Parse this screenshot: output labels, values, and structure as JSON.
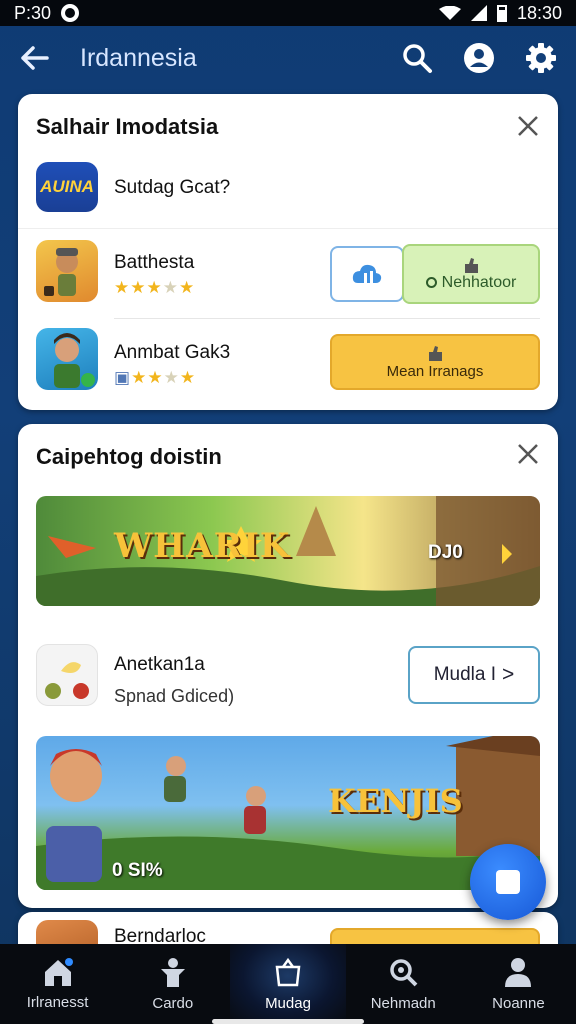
{
  "status_bar": {
    "time_left": "P:30",
    "time_right": "18:30"
  },
  "app_bar": {
    "title": "Irdannesia"
  },
  "card1": {
    "title": "Salhair Imodatsia",
    "featured": {
      "icon_text": "AUINA",
      "name": "Sutdag Gcat?"
    },
    "games": [
      {
        "name": "Batthesta",
        "rating": 4.5,
        "btn_secondary_label": "",
        "btn_primary_label": "Nehhatoor"
      },
      {
        "name": "Anmbat Gak3",
        "rating": 3.5,
        "btn_primary_label": "Mean Irranags"
      }
    ]
  },
  "card2": {
    "title": "Caipehtog doistin",
    "banner1": {
      "title": "WHARIK",
      "counter": "DJ0"
    },
    "app": {
      "name": "Anetkan1a",
      "subtitle": "Spnad Gdiced)",
      "button_label": "Mudla I",
      "button_arrow": ">"
    },
    "banner2": {
      "title": "KENJIS",
      "counter": "0 SI%"
    }
  },
  "card3": {
    "name": "Berndarloc"
  },
  "bottom_nav": [
    {
      "label": "Irlranesst",
      "icon": "home-icon"
    },
    {
      "label": "Cardo",
      "icon": "person-icon"
    },
    {
      "label": "Mudag",
      "icon": "bag-icon"
    },
    {
      "label": "Nehmadn",
      "icon": "search-icon"
    },
    {
      "label": "Noanne",
      "icon": "profile-icon"
    }
  ],
  "colors": {
    "accent_blue": "#1e6fe0",
    "yellow_btn": "#f7c342",
    "green_btn": "#d6f2b6"
  }
}
